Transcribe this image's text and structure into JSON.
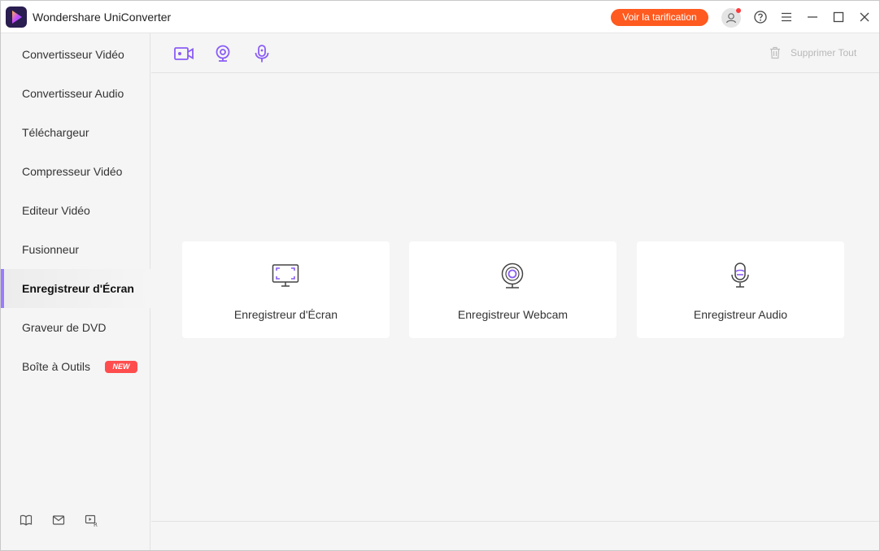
{
  "app": {
    "title": "Wondershare UniConverter",
    "pricing_button": "Voir la tarification",
    "accent_color": "#9b7bff",
    "pricing_color": "#ff5a1f"
  },
  "sidebar": {
    "items": [
      {
        "label": "Convertisseur Vidéo"
      },
      {
        "label": "Convertisseur Audio"
      },
      {
        "label": "Téléchargeur"
      },
      {
        "label": "Compresseur Vidéo"
      },
      {
        "label": "Editeur Vidéo"
      },
      {
        "label": "Fusionneur"
      },
      {
        "label": "Enregistreur d'Écran",
        "active": true
      },
      {
        "label": "Graveur de DVD"
      },
      {
        "label": "Boîte à Outils",
        "badge": "NEW"
      }
    ],
    "bottom_icons": [
      "book-icon",
      "mail-icon",
      "video-feedback-icon"
    ]
  },
  "toolbar": {
    "icons": [
      "screen-record-icon",
      "webcam-icon",
      "microphone-icon"
    ],
    "delete_all": "Supprimer Tout"
  },
  "cards": [
    {
      "label": "Enregistreur d'Écran",
      "icon": "screen-record-icon"
    },
    {
      "label": "Enregistreur Webcam",
      "icon": "webcam-icon"
    },
    {
      "label": "Enregistreur Audio",
      "icon": "microphone-icon"
    }
  ]
}
